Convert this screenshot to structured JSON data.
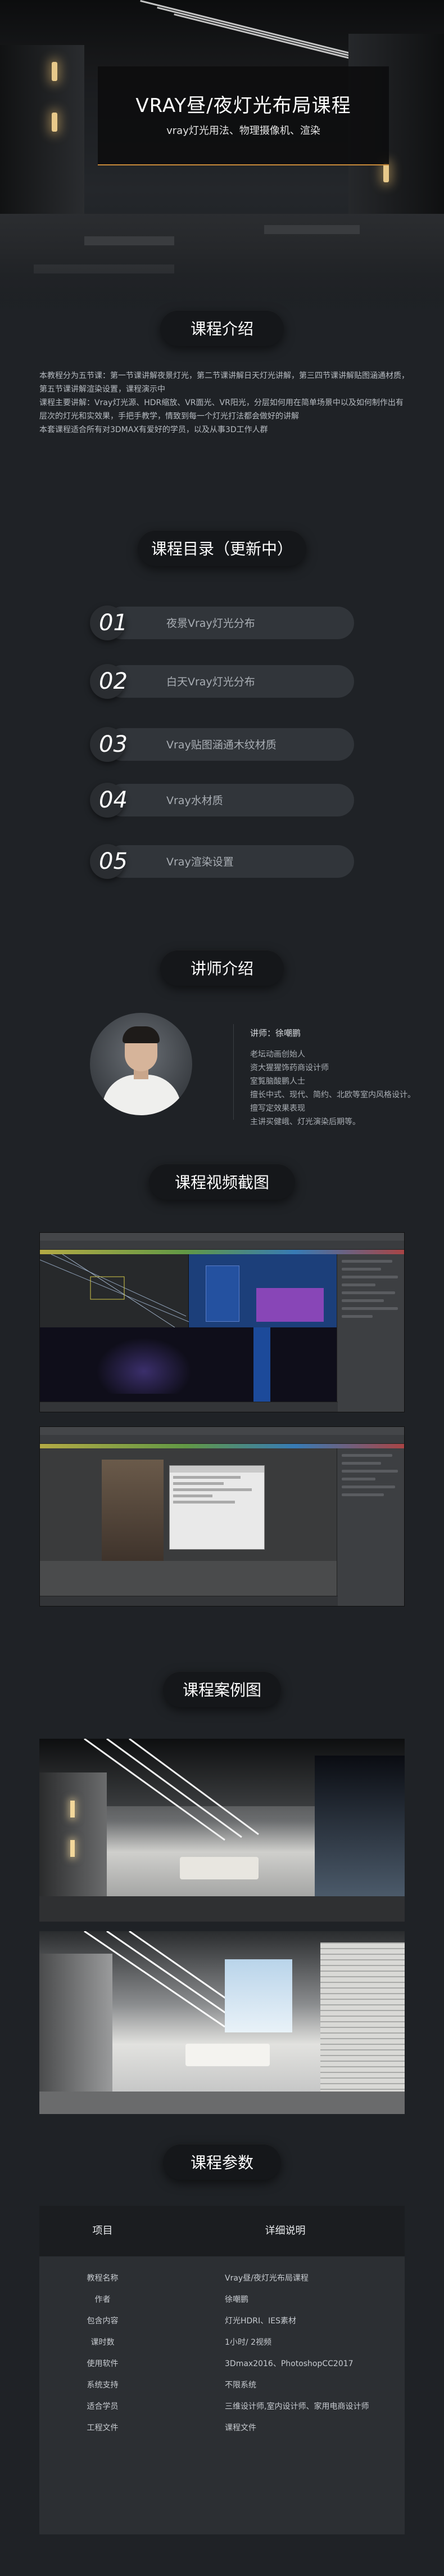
{
  "hero": {
    "title": "VRAY昼/夜灯光布局课程",
    "subtitle": "vray灯光用法、物理摄像机、渲染"
  },
  "intro": {
    "heading": "课程介绍",
    "paragraphs": [
      "本教程分为五节课：第一节课讲解夜景灯光，第二节课讲解日天灯光讲解，第三四节课讲解贴图涵通材质，第五节课讲解渲染设置，课程演示中",
      "课程主要讲解：Vray灯光源、HDR缩放、VR面光、VR阳光，分层如何用在简单场景中以及如何制作出有层次的灯光和实效果，手把手教学，情致到每一个灯光打法都会做好的讲解",
      "本套课程适合所有对3DMAX有爱好的学员，以及从事3D工作人群"
    ]
  },
  "catalog": {
    "heading": "课程目录（更新中）",
    "items": [
      {
        "num": "01",
        "label": "夜景Vray灯光分布"
      },
      {
        "num": "02",
        "label": "白天Vray灯光分布"
      },
      {
        "num": "03",
        "label": "Vray贴图涵通木纹材质"
      },
      {
        "num": "04",
        "label": "Vray水材质"
      },
      {
        "num": "05",
        "label": "Vray渲染设置"
      }
    ]
  },
  "teacher": {
    "heading": "讲师介绍",
    "name": "讲师：徐嘲鹏",
    "lines": [
      "老坛动画创始人",
      "资大猩猩饰药商设计师",
      "室覧脑酸鹏人士",
      "擅长中式、现代、简约、北欧等室内风格设计。",
      "擅写定效果表现",
      "主讲买健峨、灯光演染后期等。"
    ]
  },
  "screenshots": {
    "heading": "课程视频截图"
  },
  "cases": {
    "heading": "课程案例图"
  },
  "params": {
    "heading": "课程参数",
    "col_key": "项目",
    "col_val": "详细说明",
    "rows": [
      {
        "k": "教程名称",
        "v": "Vray昼/夜灯光布局课程"
      },
      {
        "k": "作者",
        "v": "徐嘲鹏"
      },
      {
        "k": "包含内容",
        "v": "灯光HDRI、IES素材"
      },
      {
        "k": "课时数",
        "v": "1小时/ 2视频"
      },
      {
        "k": "使用软件",
        "v": "3Dmax2016、PhotoshopCC2017"
      },
      {
        "k": "系统支持",
        "v": "不限系统"
      },
      {
        "k": "适合学员",
        "v": "三维设计师,室内设计师、家用电商设计师"
      },
      {
        "k": "工程文件",
        "v": "课程文件"
      }
    ]
  },
  "colors": {
    "background": "#1f2226",
    "pill": "#15171a",
    "accent": "#c88a3a"
  }
}
